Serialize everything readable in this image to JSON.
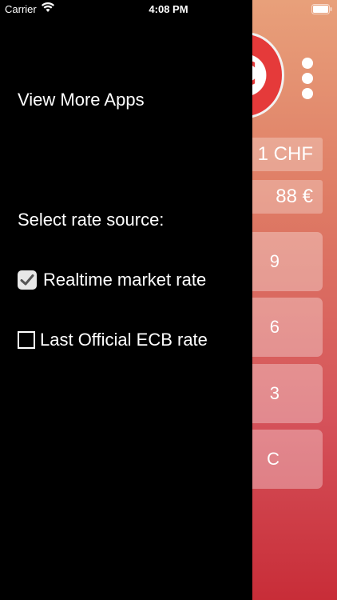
{
  "status_bar": {
    "carrier": "Carrier",
    "time": "4:08 PM",
    "wifi_icon": "wifi-icon",
    "battery_icon": "battery-icon"
  },
  "drawer": {
    "view_more_apps": "View More Apps",
    "rate_source_label": "Select rate source:",
    "options": [
      {
        "label": "Realtime market rate",
        "checked": true
      },
      {
        "label": "Last Official ECB rate",
        "checked": false
      }
    ]
  },
  "background_app": {
    "logo_icon": "euro-logo-icon",
    "menu_icon": "vertical-ellipsis-icon",
    "source_currency": "1 CHF",
    "target_value": "88 €",
    "keys": [
      "9",
      "6",
      "3",
      "C"
    ]
  },
  "colors": {
    "drawer_bg": "#000000",
    "gradient_top": "#e8a07a",
    "gradient_bottom": "#c82d38",
    "logo_red": "#e53a3a"
  }
}
